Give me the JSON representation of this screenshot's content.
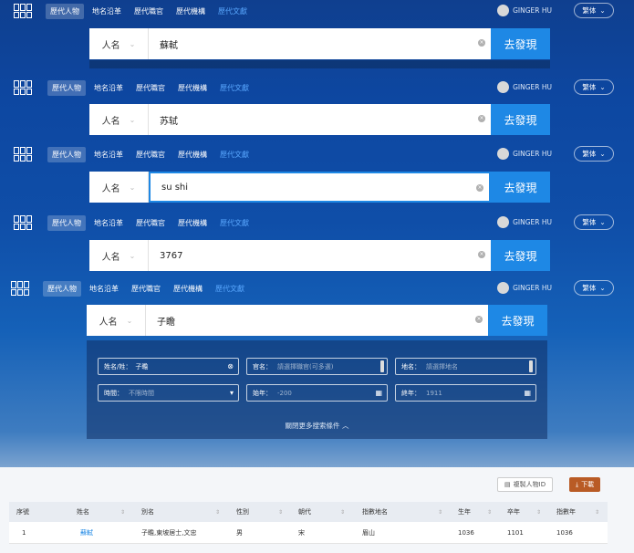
{
  "header": {
    "nav": [
      "歷代人物",
      "地名沿革",
      "歷代職官",
      "歷代機構",
      "歷代文獻"
    ],
    "user": "GINGER HU",
    "lang": "繁体"
  },
  "searches": [
    {
      "category": "人名",
      "value": "蘇軾"
    },
    {
      "category": "人名",
      "value": "苏轼"
    },
    {
      "category": "人名",
      "value": "su shi"
    },
    {
      "category": "人名",
      "value": "3767"
    },
    {
      "category": "人名",
      "value": "子瞻"
    }
  ],
  "search_button": "去發現",
  "advanced": {
    "name_label": "姓名/姓：",
    "name_value": "子瞻",
    "office_label": "官名：",
    "office_placeholder": "請選擇職官(可多選)",
    "place_label": "地名：",
    "place_placeholder": "請選擇地名",
    "time_label": "時間：",
    "time_placeholder": "不限時間",
    "start_label": "始年：",
    "start_placeholder": "-200",
    "end_label": "終年：",
    "end_placeholder": "1911",
    "collapse": "關閉更多搜索條件"
  },
  "results": {
    "copy_button": "複製人物ID",
    "download_button": "下載",
    "columns": [
      "序號",
      "姓名",
      "別名",
      "性別",
      "朝代",
      "指數地名",
      "生年",
      "卒年",
      "指數年"
    ],
    "rows": [
      {
        "index": "1",
        "name": "蘇軾",
        "alias": "子瞻,東坡居士,文忠",
        "gender": "男",
        "dynasty": "宋",
        "place": "眉山",
        "birth": "1036",
        "death": "1101",
        "index_year": "1036"
      }
    ]
  },
  "colors": {
    "accent": "#1e88e5",
    "download": "#b95b25",
    "bg": "#0d47a1"
  }
}
